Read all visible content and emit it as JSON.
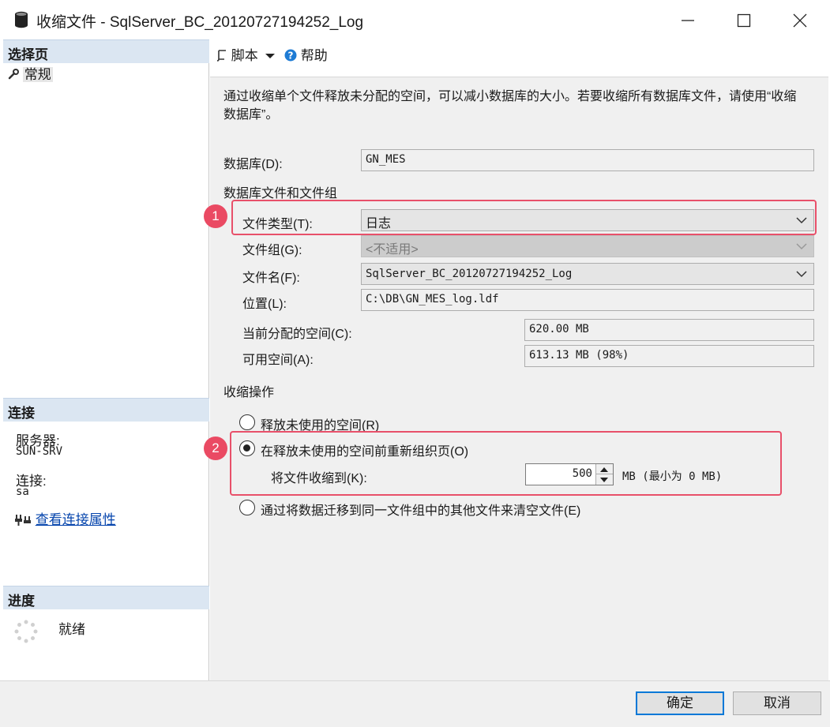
{
  "window": {
    "title": "收缩文件 - SqlServer_BC_20120727194252_Log",
    "app_icon": "database-icon"
  },
  "left_pane": {
    "select_page_header": "选择页",
    "pages": [
      {
        "label": "常规",
        "icon": "wrench-icon"
      }
    ],
    "connection_header": "连接",
    "server_label": "服务器:",
    "server_value": "SUN-SRV",
    "connection_label": "连接:",
    "connection_value": "sa",
    "view_props_link": "查看连接属性",
    "progress_header": "进度",
    "progress_status": "就绪"
  },
  "toolbar": {
    "script_label": "脚本",
    "help_label": "帮助"
  },
  "main": {
    "description": "通过收缩单个文件释放未分配的空间，可以减小数据库的大小。若要收缩所有数据库文件，请使用“收缩数据库”。",
    "database_label": "数据库(D):",
    "database_value": "GN_MES",
    "files_group_heading": "数据库文件和文件组",
    "file_type_label": "文件类型(T):",
    "file_type_value": "日志",
    "filegroup_label": "文件组(G):",
    "filegroup_value": "<不适用>",
    "file_name_label": "文件名(F):",
    "file_name_value": "SqlServer_BC_20120727194252_Log",
    "location_label": "位置(L):",
    "location_value": "C:\\DB\\GN_MES_log.ldf",
    "allocated_label": "当前分配的空间(C):",
    "allocated_value": "620.00 MB",
    "available_label": "可用空间(A):",
    "available_value": "613.13 MB (98%)",
    "shrink_heading": "收缩操作",
    "option_release": "释放未使用的空间(R)",
    "option_reorganize": "在释放未使用的空间前重新组织页(O)",
    "shrink_to_label": "将文件收缩到(K):",
    "shrink_to_value": "500",
    "shrink_to_unit": "MB (最小为 0 MB)",
    "option_empty": "通过将数据迁移到同一文件组中的其他文件来清空文件(E)",
    "selected_option": "reorganize",
    "callout_1": "1",
    "callout_2": "2",
    "callout_color": "#ea4a63"
  },
  "footer": {
    "ok_label": "确定",
    "cancel_label": "取消"
  }
}
